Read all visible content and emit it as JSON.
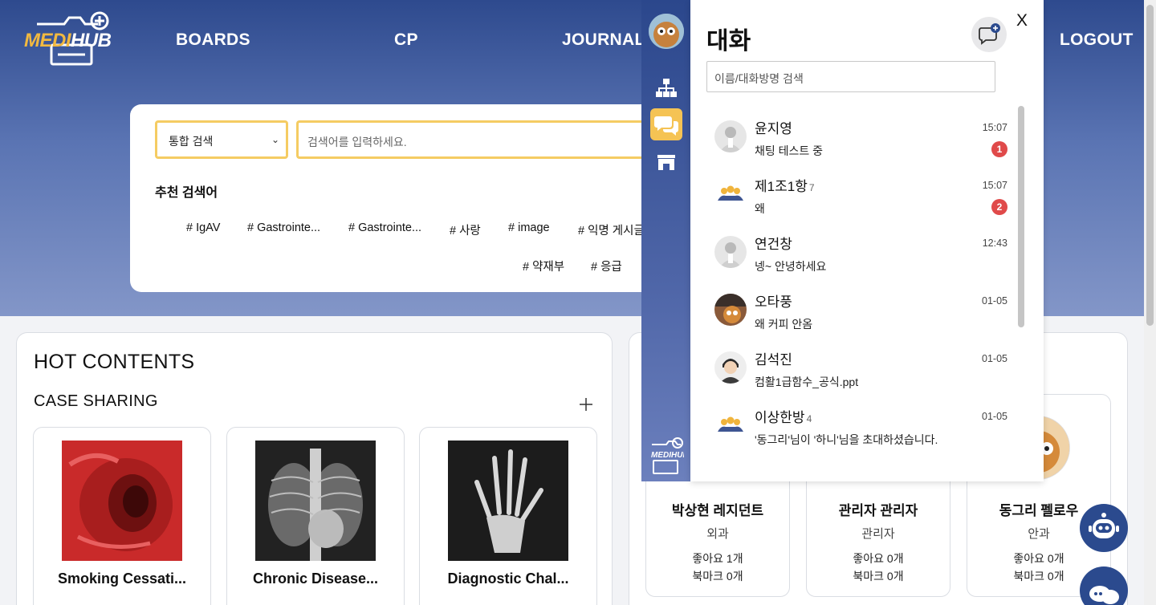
{
  "brand": {
    "logo_m": "MEDI",
    "logo_h": "HUB"
  },
  "nav": {
    "boards": "BOARDS",
    "cp": "CP",
    "journal": "JOURNAL",
    "logout": "LOGOUT"
  },
  "search": {
    "select_value": "통합 검색",
    "placeholder": "검색어를 입력하세요.",
    "recommended_title": "추천 검색어",
    "tags": [
      "# IgAV",
      "# Gastrointe...",
      "# Gastrointe...",
      "# 사랑",
      "# image",
      "# 익명 게시글",
      "# 약재부",
      "# 응급"
    ]
  },
  "hot": {
    "title": "HOT CONTENTS",
    "section": "CASE SHARING",
    "cases": [
      {
        "name": "Smoking Cessati..."
      },
      {
        "name": "Chronic Disease..."
      },
      {
        "name": "Diagnostic Chal..."
      }
    ]
  },
  "profiles": [
    {
      "name": "박상현 레지던트",
      "dept": "외과",
      "likes": "좋아요 1개",
      "bookmarks": "북마크 0개"
    },
    {
      "name": "관리자 관리자",
      "dept": "관리자",
      "likes": "좋아요 0개",
      "bookmarks": "북마크 0개"
    },
    {
      "name": "동그리 펠로우",
      "dept": "안과",
      "likes": "좋아요 0개",
      "bookmarks": "북마크 0개"
    }
  ],
  "chat": {
    "title": "대화",
    "close": "X",
    "search_placeholder": "이름/대화방명 검색",
    "rooms": [
      {
        "name": "윤지영",
        "count": "",
        "message": "채팅 테스트 중",
        "time": "15:07",
        "unread": "1",
        "avatar": "doctor"
      },
      {
        "name": "제1조1항",
        "count": "7",
        "message": "왜",
        "time": "15:07",
        "unread": "2",
        "avatar": "group"
      },
      {
        "name": "연건창",
        "count": "",
        "message": "넹~ 안녕하세요",
        "time": "12:43",
        "unread": "",
        "avatar": "doctor"
      },
      {
        "name": "오타풍",
        "count": "",
        "message": "왜 커피 안옴",
        "time": "01-05",
        "unread": "",
        "avatar": "photo"
      },
      {
        "name": "김석진",
        "count": "",
        "message": "컴활1급함수_공식.ppt",
        "time": "01-05",
        "unread": "",
        "avatar": "person"
      },
      {
        "name": "이상한방",
        "count": "4",
        "message": "'동그리'님이 '하니'님을 초대하셨습니다.",
        "time": "01-05",
        "unread": "",
        "avatar": "group"
      }
    ]
  },
  "colors": {
    "accent": "#f5c354",
    "primary": "#2b4a8e",
    "badge": "#e04a4a",
    "input_border": "#f5cc63"
  }
}
